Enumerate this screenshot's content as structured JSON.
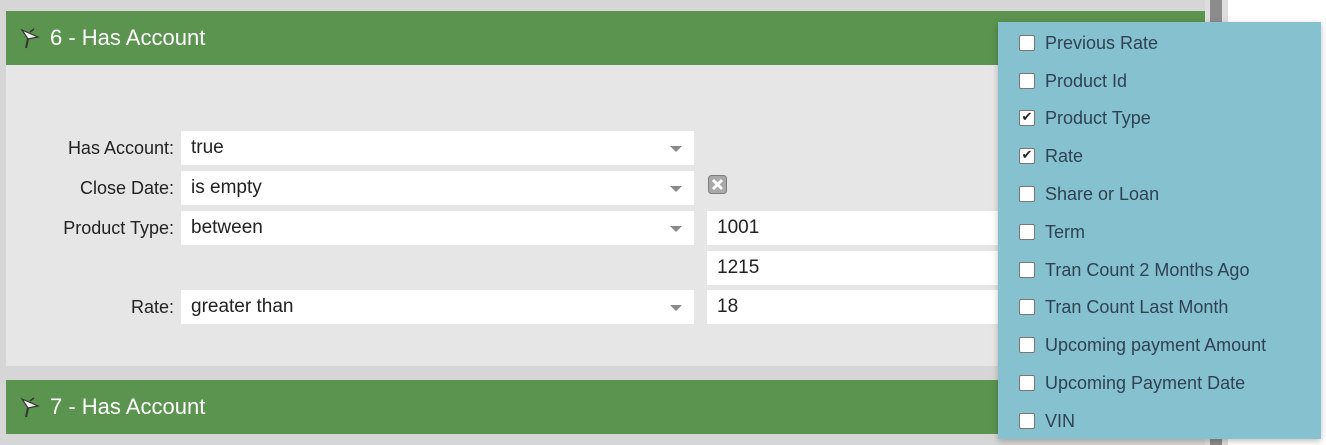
{
  "sections": [
    {
      "title": "6 - Has Account"
    },
    {
      "title": "7 - Has Account"
    }
  ],
  "filters": [
    {
      "label": "Has Account:",
      "operator": "true",
      "values": []
    },
    {
      "label": "Close Date:",
      "operator": "is empty",
      "values": []
    },
    {
      "label": "Product Type:",
      "operator": "between",
      "values": [
        "1001",
        "1215"
      ]
    },
    {
      "label": "Rate:",
      "operator": "greater than",
      "values": [
        "18"
      ]
    }
  ],
  "icons": {
    "section": "funnel-flag-icon",
    "remove": "close-icon",
    "dropdown": "caret-down-icon"
  },
  "column_options": [
    {
      "label": "Previous Rate",
      "checked": false
    },
    {
      "label": "Product Id",
      "checked": false
    },
    {
      "label": "Product Type",
      "checked": true
    },
    {
      "label": "Rate",
      "checked": true
    },
    {
      "label": "Share or Loan",
      "checked": false
    },
    {
      "label": "Term",
      "checked": false
    },
    {
      "label": "Tran Count 2 Months Ago",
      "checked": false
    },
    {
      "label": "Tran Count Last Month",
      "checked": false
    },
    {
      "label": "Upcoming payment Amount",
      "checked": false
    },
    {
      "label": "Upcoming Payment Date",
      "checked": false
    },
    {
      "label": "VIN",
      "checked": false
    }
  ],
  "colors": {
    "header_green": "#5b944e",
    "panel_blue": "#86c1d0",
    "body_gray": "#e6e6e6"
  }
}
